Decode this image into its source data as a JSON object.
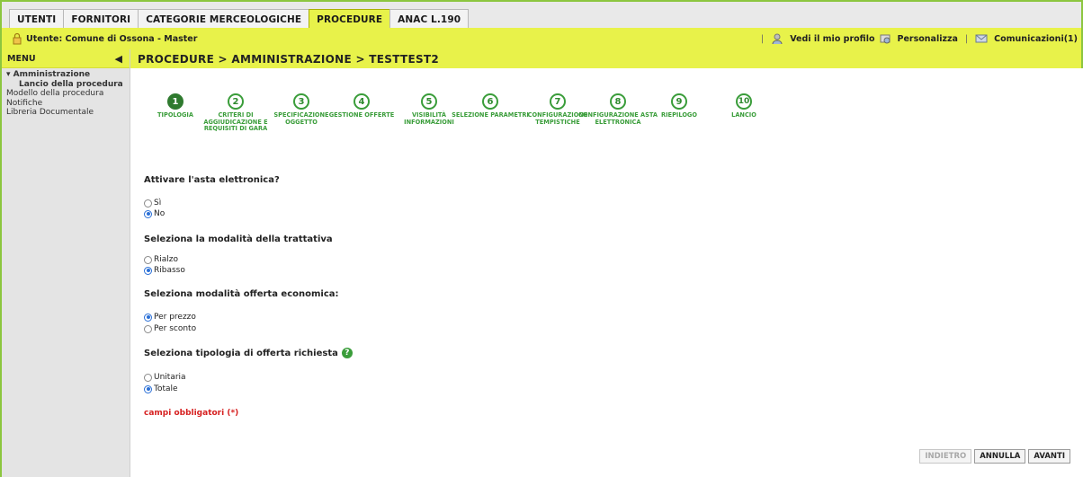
{
  "tabs": [
    "UTENTI",
    "FORNITORI",
    "CATEGORIE MERCEOLOGICHE",
    "PROCEDURE",
    "ANAC L.190"
  ],
  "active_tab": 3,
  "userbar": {
    "user_label": "Utente: Comune di Ossona - Master",
    "profile_link": "Vedi il mio profilo",
    "customize_link": "Personalizza",
    "messages_link": "Comunicazioni(1)",
    "separator": "|"
  },
  "menu": {
    "title": "MENU",
    "collapse_glyph": "◀",
    "group": "▾ Amministrazione",
    "sub_item": "Lancio della procedura",
    "items": [
      "Modello della procedura",
      "Notifiche",
      "Libreria Documentale"
    ]
  },
  "breadcrumb": "PROCEDURE  > AMMINISTRAZIONE  > TESTTEST2",
  "steps": [
    {
      "num": "1",
      "label": "TIPOLOGIA",
      "done": true
    },
    {
      "num": "2",
      "label": "CRITERI DI AGGIUDICAZIONE E REQUISITI DI GARA",
      "done": false
    },
    {
      "num": "3",
      "label": "SPECIFICAZIONE OGGETTO",
      "done": false
    },
    {
      "num": "4",
      "label": "GESTIONE OFFERTE",
      "done": false
    },
    {
      "num": "5",
      "label": "VISIBILITÀ INFORMAZIONI",
      "done": false
    },
    {
      "num": "6",
      "label": "SELEZIONE PARAMETRI",
      "done": false
    },
    {
      "num": "7",
      "label": "CONFIGURAZIONE TEMPISTICHE",
      "done": false
    },
    {
      "num": "8",
      "label": "CONFIGURAZIONE ASTA ELETTRONICA",
      "done": false
    },
    {
      "num": "9",
      "label": "RIEPILOGO",
      "done": false
    },
    {
      "num": "10",
      "label": "LANCIO",
      "done": false
    }
  ],
  "form": {
    "q1": "Attivare l'asta elettronica?",
    "q1_opts": [
      {
        "label": "Sì",
        "checked": false
      },
      {
        "label": "No",
        "checked": true
      }
    ],
    "q2": "Seleziona la modalità della trattativa",
    "q2_opts": [
      {
        "label": "Rialzo",
        "checked": false
      },
      {
        "label": "Ribasso",
        "checked": true
      }
    ],
    "q3": "Seleziona modalità offerta economica:",
    "q3_opts": [
      {
        "label": "Per prezzo",
        "checked": true
      },
      {
        "label": "Per sconto",
        "checked": false
      }
    ],
    "q4": "Seleziona tipologia di offerta richiesta",
    "q4_help": "?",
    "q4_opts": [
      {
        "label": "Unitaria",
        "checked": false
      },
      {
        "label": "Totale",
        "checked": true
      }
    ],
    "required_note": "campi obbligatori (*)"
  },
  "buttons": {
    "back": "INDIETRO",
    "cancel": "ANNULLA",
    "next": "AVANTI"
  },
  "colors": {
    "accent_green": "#3a9d3a",
    "yellow_bar": "#e8f24a",
    "required_red": "#d62020"
  }
}
